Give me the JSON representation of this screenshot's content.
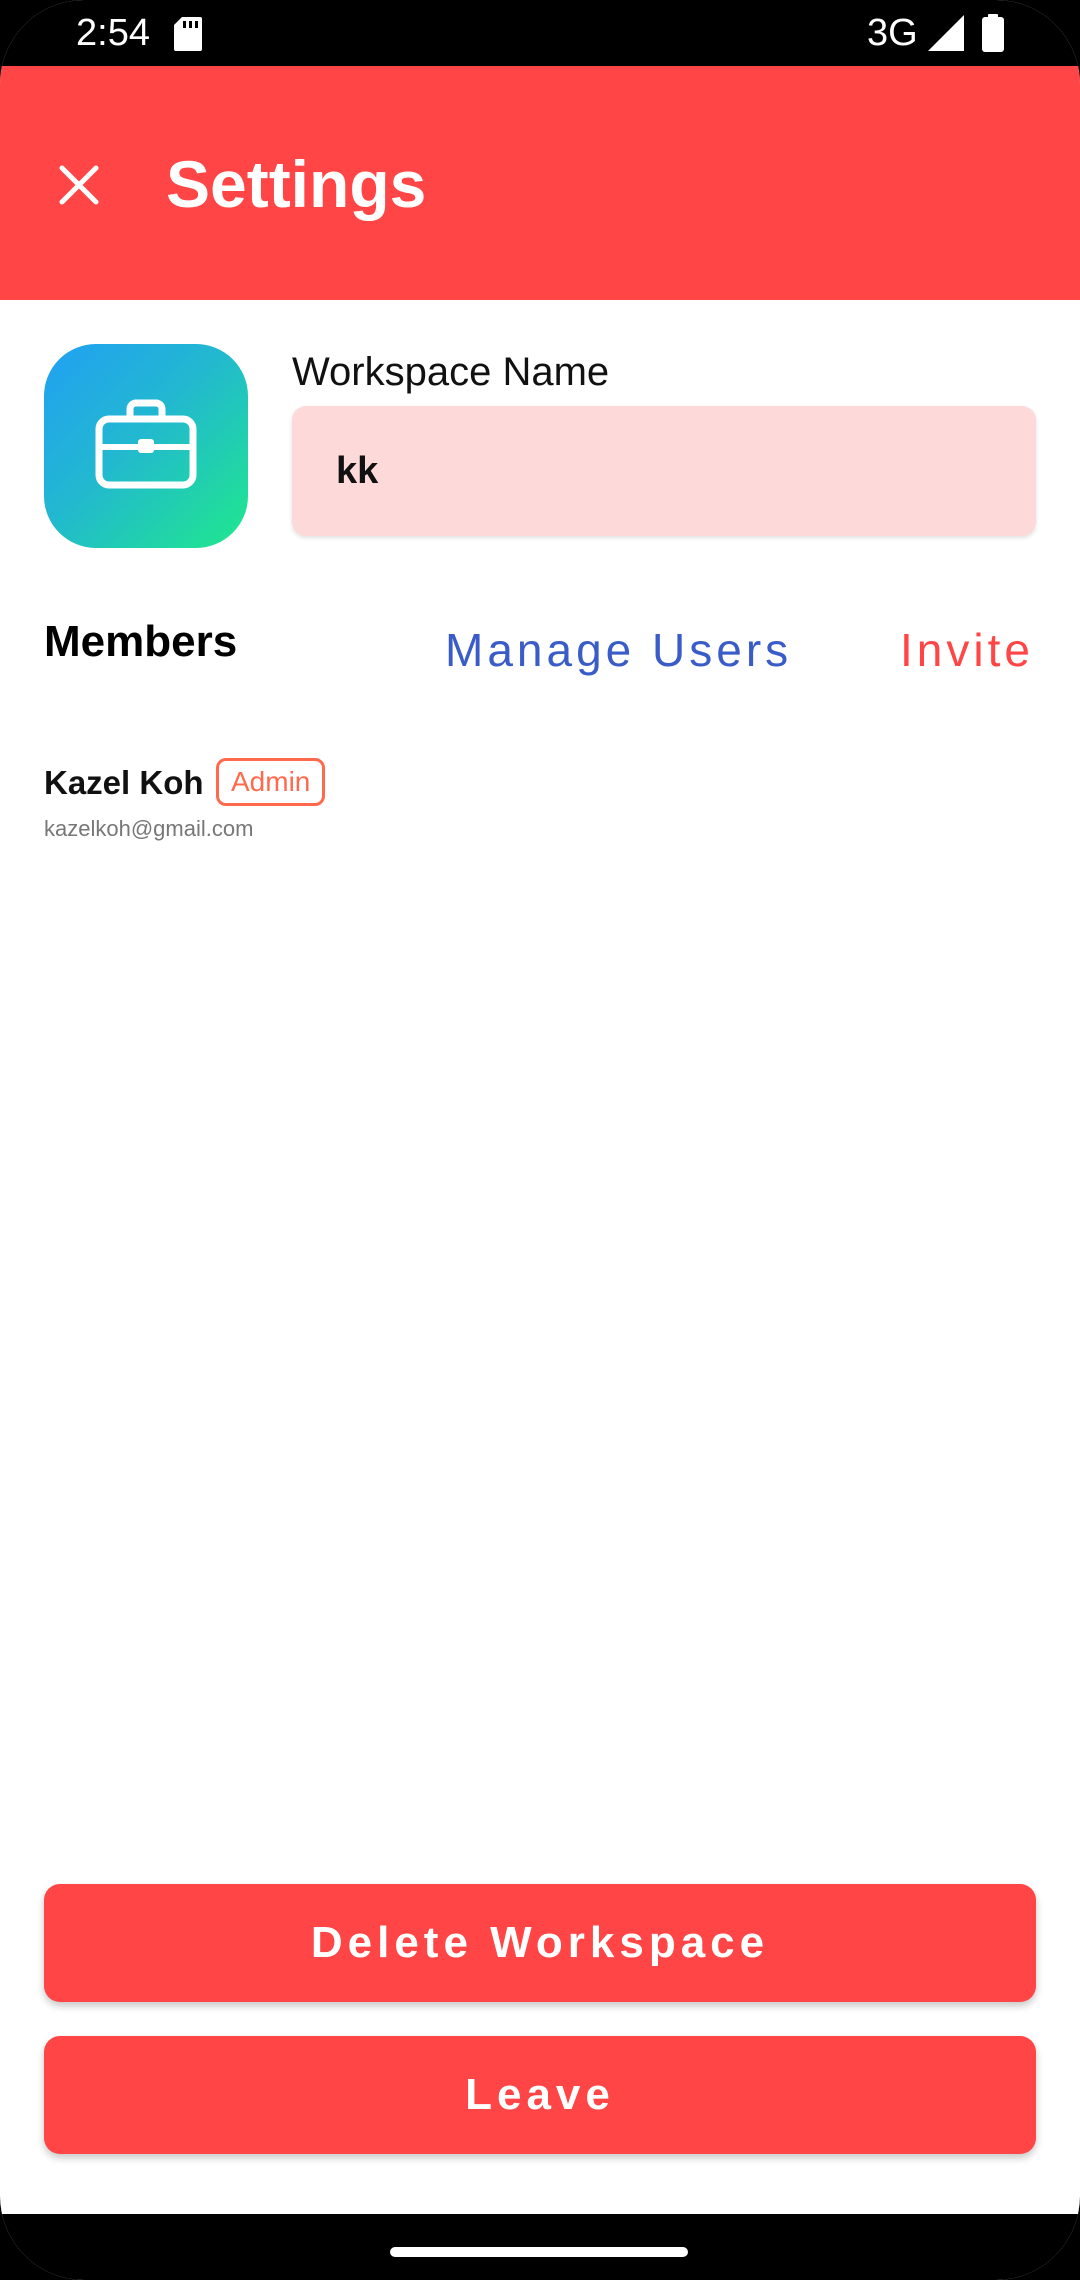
{
  "status_bar": {
    "time": "2:54",
    "network": "3G",
    "sd_icon": "sd-card-icon",
    "signal_icon": "cellular-signal-icon",
    "battery_icon": "battery-full-icon"
  },
  "app_bar": {
    "title": "Settings",
    "close_icon": "close-icon",
    "color": "#ff4545"
  },
  "workspace": {
    "icon": "briefcase-icon",
    "name_label": "Workspace Name",
    "name_value": "kk"
  },
  "members": {
    "heading": "Members",
    "manage_users_label": "Manage Users",
    "invite_label": "Invite",
    "items": [
      {
        "name": "Kazel Koh",
        "role": "Admin",
        "email": "kazelkoh@gmail.com"
      }
    ]
  },
  "actions": {
    "delete_label": "Delete Workspace",
    "leave_label": "Leave"
  },
  "colors": {
    "accent": "#ff4545",
    "link_blue": "#3a5cc8",
    "input_bg": "#fdd9d9",
    "badge": "#ff6a4d"
  }
}
